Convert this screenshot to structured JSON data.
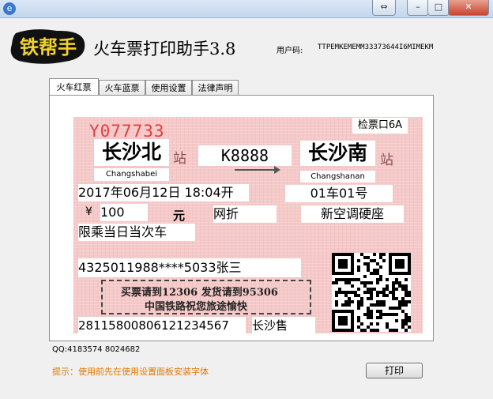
{
  "window": {
    "icon_glyph": "e",
    "controls": {
      "restore": "⇔",
      "minimize": "–",
      "maximize": "□",
      "close": "✕"
    }
  },
  "header": {
    "logo_text": "铁帮手",
    "title": "火车票打印助手3.8",
    "user_label": "用户码:",
    "user_code": "TTPEMKEMEMM33373644I6MIMEKM"
  },
  "tabs": [
    {
      "label": "火车红票",
      "active": true
    },
    {
      "label": "火车蓝票",
      "active": false
    },
    {
      "label": "使用设置",
      "active": false
    },
    {
      "label": "法律声明",
      "active": false
    }
  ],
  "ticket": {
    "serial": "Y077733",
    "gate": "检票口6A",
    "from_station": "长沙北",
    "from_pinyin": "Changshabei",
    "to_station": "长沙南",
    "to_pinyin": "Changshanan",
    "station_suffix": "站",
    "train_no": "K8888",
    "datetime": "2017年06月12日 18:04开",
    "seat": "01车01号",
    "currency": "¥",
    "price": "100",
    "yuan": "元",
    "discount": "网折",
    "seat_type": "新空调硬座",
    "limit": "限乘当日当次车",
    "passenger": "4325011988****5033张三",
    "hotline": "买票请到12306 发货请到95306",
    "slogan": "中国铁路祝您旅途愉快",
    "ticket_number": "28115800806121234567",
    "sell_station": "长沙售"
  },
  "footer": {
    "qq": "QQ:4183574   8024682",
    "hint": "提示：使用前先在使用设置面板安装字体",
    "print_label": "打印"
  },
  "colors": {
    "ticket_bg": "#f4c9c8",
    "serial": "#e43e3e",
    "hint": "#e07800",
    "logo_bg": "#f2d228"
  }
}
